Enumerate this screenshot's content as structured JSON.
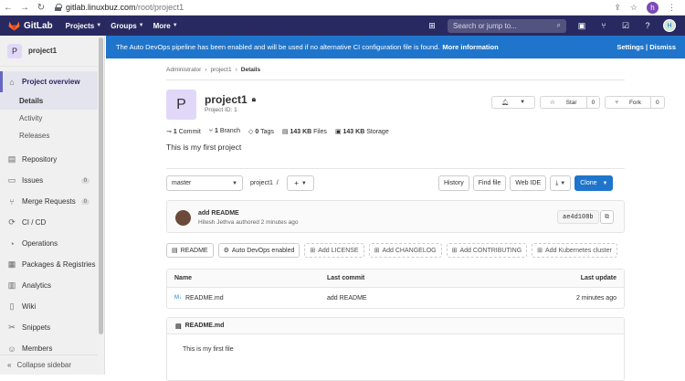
{
  "browser": {
    "url_host": "gitlab.linuxbuz.com",
    "url_path": "/root/project1",
    "profile_initial": "h"
  },
  "topnav": {
    "brand": "GitLab",
    "menus": [
      "Projects",
      "Groups",
      "More"
    ],
    "search_placeholder": "Search or jump to...",
    "user_initial": "H"
  },
  "sidebar": {
    "project_avatar": "P",
    "project_name": "project1",
    "overview_label": "Project overview",
    "overview_sub": [
      "Details",
      "Activity",
      "Releases"
    ],
    "items": [
      {
        "label": "Repository",
        "icon": "repository-icon"
      },
      {
        "label": "Issues",
        "badge": "0",
        "icon": "issues-icon"
      },
      {
        "label": "Merge Requests",
        "badge": "0",
        "icon": "merge-request-icon"
      },
      {
        "label": "CI / CD",
        "icon": "ci-cd-icon"
      },
      {
        "label": "Operations",
        "icon": "operations-icon"
      },
      {
        "label": "Packages & Registries",
        "icon": "packages-icon"
      },
      {
        "label": "Analytics",
        "icon": "analytics-icon"
      },
      {
        "label": "Wiki",
        "icon": "wiki-icon"
      },
      {
        "label": "Snippets",
        "icon": "snippets-icon"
      },
      {
        "label": "Members",
        "icon": "members-icon"
      }
    ],
    "collapse_label": "Collapse sidebar"
  },
  "banner": {
    "text": "The Auto DevOps pipeline has been enabled and will be used if no alternative CI configuration file is found.",
    "link": "More information",
    "settings": "Settings",
    "dismiss": "Dismiss"
  },
  "breadcrumb": [
    "Administrator",
    "project1",
    "Details"
  ],
  "project": {
    "avatar": "P",
    "title": "project1",
    "id_text": "Project ID: 1",
    "star_label": "Star",
    "star_count": "0",
    "fork_label": "Fork",
    "fork_count": "0",
    "description": "This is my first project"
  },
  "stats": {
    "commits_n": "1",
    "commits_l": "Commit",
    "branch_n": "1",
    "branch_l": "Branch",
    "tags_n": "0",
    "tags_l": "Tags",
    "files_n": "143 KB",
    "files_l": "Files",
    "storage_n": "143 KB",
    "storage_l": "Storage"
  },
  "repo_toolbar": {
    "branch": "master",
    "path": "project1",
    "path_sep": "/",
    "history": "History",
    "find_file": "Find file",
    "web_ide": "Web IDE",
    "clone": "Clone"
  },
  "last_commit": {
    "title": "add README",
    "author": "Hitesh Jethva",
    "meta": "authored 2 minutes ago",
    "sha": "ae4d108b"
  },
  "quick_links": {
    "readme": "README",
    "autodevops": "Auto DevOps enabled",
    "add_license": "Add LICENSE",
    "add_changelog": "Add CHANGELOG",
    "add_contributing": "Add CONTRIBUTING",
    "add_k8s": "Add Kubernetes cluster"
  },
  "file_table": {
    "headers": {
      "name": "Name",
      "commit": "Last commit",
      "update": "Last update"
    },
    "rows": [
      {
        "name": "README.md",
        "commit": "add README",
        "update": "2 minutes ago"
      }
    ]
  },
  "readme_panel": {
    "title": "README.md",
    "body": "This is my first file"
  }
}
